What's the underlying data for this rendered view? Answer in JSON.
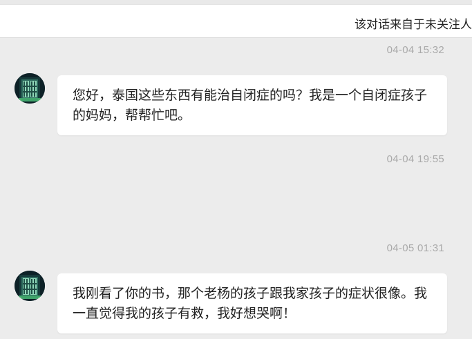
{
  "notice": {
    "text": "该对话来自于未关注人"
  },
  "messages": [
    {
      "time": "04-04 15:32",
      "text": "您好，泰国这些东西有能治自闭症的吗？我是一个自闭症孩子的妈妈，帮帮忙吧。"
    },
    {
      "time": "04-04 19:55"
    },
    {
      "time": "04-05 01:31",
      "text": "我刚看了你的书，那个老杨的孩子跟我家孩子的症状很像。我一直觉得我的孩子有救，我好想哭啊！"
    }
  ]
}
